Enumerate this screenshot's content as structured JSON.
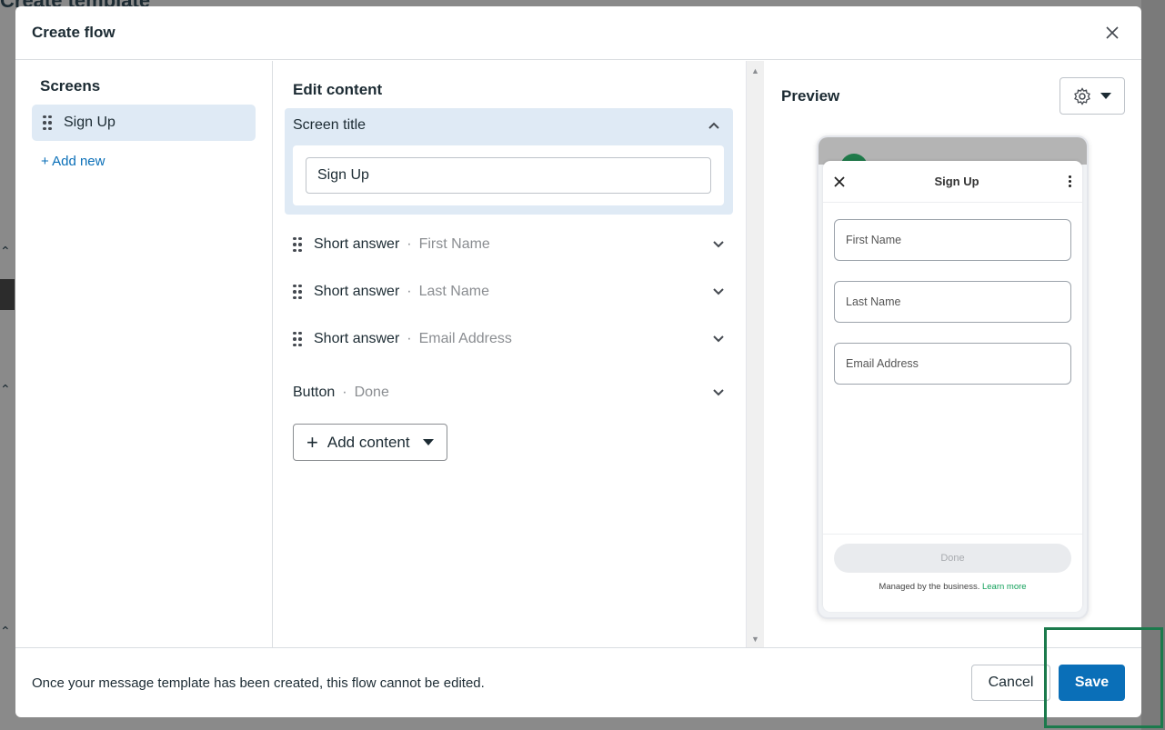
{
  "background": {
    "page_title": "Create template"
  },
  "modal": {
    "title": "Create flow",
    "close_icon": "close-icon"
  },
  "screens": {
    "heading": "Screens",
    "items": [
      {
        "label": "Sign Up",
        "selected": true
      }
    ],
    "add_new": "+ Add new"
  },
  "edit": {
    "heading": "Edit content",
    "screen_title_section": {
      "label": "Screen title",
      "expanded": true,
      "input_value": "Sign Up"
    },
    "components": [
      {
        "type": "Short answer",
        "label": "First Name"
      },
      {
        "type": "Short answer",
        "label": "Last Name"
      },
      {
        "type": "Short answer",
        "label": "Email Address"
      }
    ],
    "button_component": {
      "type": "Button",
      "label": "Done"
    },
    "separator": "·",
    "add_content": "Add content"
  },
  "preview": {
    "heading": "Preview",
    "settings_icon": "gear-icon",
    "phone": {
      "title": "Sign Up",
      "fields": [
        "First Name",
        "Last Name",
        "Email Address"
      ],
      "done_label": "Done",
      "managed_text": "Managed by the business.",
      "learn_more": "Learn more"
    }
  },
  "footer": {
    "note": "Once your message template has been created, this flow cannot be edited.",
    "cancel_label": "Cancel",
    "save_label": "Save"
  },
  "colors": {
    "accent": "#0a6fb8",
    "selected_bg": "#dfeaf5",
    "highlight": "#1b7a4c"
  }
}
